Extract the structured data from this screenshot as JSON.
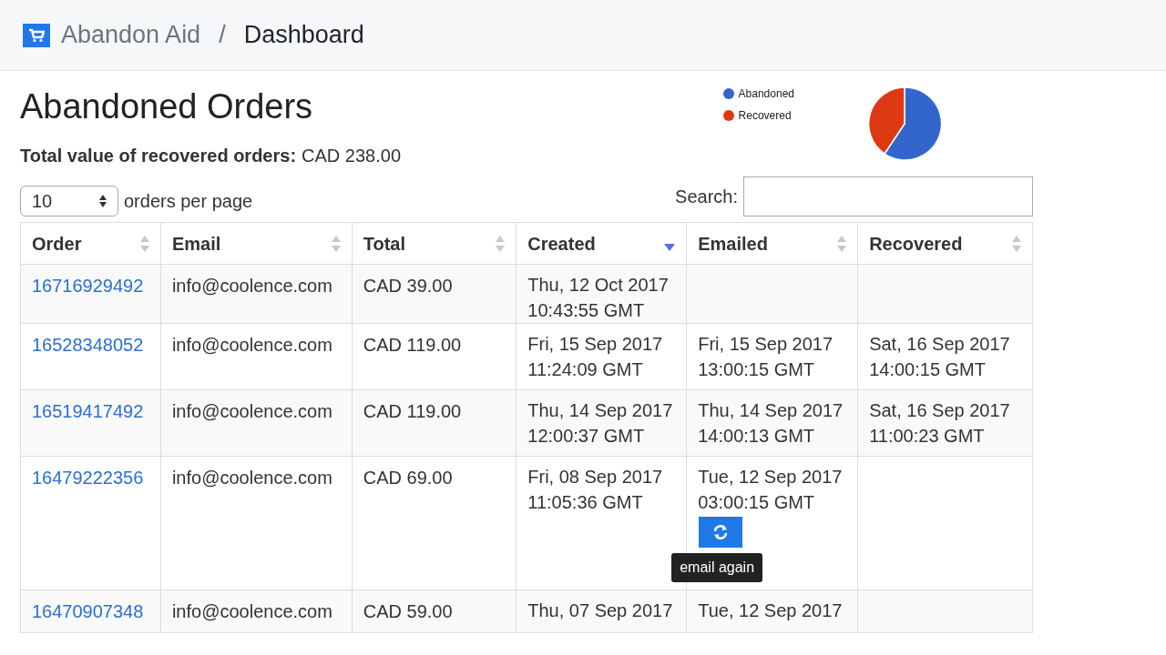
{
  "header": {
    "brand": "Abandon Aid",
    "separator": "/",
    "page": "Dashboard"
  },
  "title": "Abandoned Orders",
  "summary": {
    "label": "Total value of recovered orders:",
    "value": "CAD 238.00"
  },
  "page_size": {
    "value": "10",
    "label": "orders per page"
  },
  "search": {
    "label": "Search:"
  },
  "legend": [
    {
      "label": "Abandoned",
      "color": "#3366cc"
    },
    {
      "label": "Recovered",
      "color": "#dc3912"
    }
  ],
  "table": {
    "columns": [
      {
        "label": "Order",
        "sorted": false
      },
      {
        "label": "Email",
        "sorted": false
      },
      {
        "label": "Total",
        "sorted": false
      },
      {
        "label": "Created",
        "sorted": true
      },
      {
        "label": "Emailed",
        "sorted": false
      },
      {
        "label": "Recovered",
        "sorted": false
      }
    ],
    "rows": [
      {
        "order": "16716929492",
        "email": "info@coolence.com",
        "total": "CAD 39.00",
        "created": [
          "Thu, 12 Oct 2017",
          "10:43:55 GMT"
        ],
        "emailed": [],
        "recovered": []
      },
      {
        "order": "16528348052",
        "email": "info@coolence.com",
        "total": "CAD 119.00",
        "created": [
          "Fri, 15 Sep 2017",
          "11:24:09 GMT"
        ],
        "emailed": [
          "Fri, 15 Sep 2017",
          "13:00:15 GMT"
        ],
        "recovered": [
          "Sat, 16 Sep 2017",
          "14:00:15 GMT"
        ]
      },
      {
        "order": "16519417492",
        "email": "info@coolence.com",
        "total": "CAD 119.00",
        "created": [
          "Thu, 14 Sep 2017",
          "12:00:37 GMT"
        ],
        "emailed": [
          "Thu, 14 Sep 2017",
          "14:00:13 GMT"
        ],
        "recovered": [
          "Sat, 16 Sep 2017",
          "11:00:23 GMT"
        ]
      },
      {
        "order": "16479222356",
        "email": "info@coolence.com",
        "total": "CAD 69.00",
        "created": [
          "Fri, 08 Sep 2017",
          "11:05:36 GMT"
        ],
        "emailed": [
          "Tue, 12 Sep 2017",
          "03:00:15 GMT"
        ],
        "recovered": [],
        "resend": {
          "tooltip": "email again"
        }
      },
      {
        "order": "16470907348",
        "email": "info@coolence.com",
        "total": "CAD 59.00",
        "created": [
          "Thu, 07 Sep 2017"
        ],
        "emailed": [
          "Tue, 12 Sep 2017"
        ],
        "recovered": []
      }
    ]
  }
}
